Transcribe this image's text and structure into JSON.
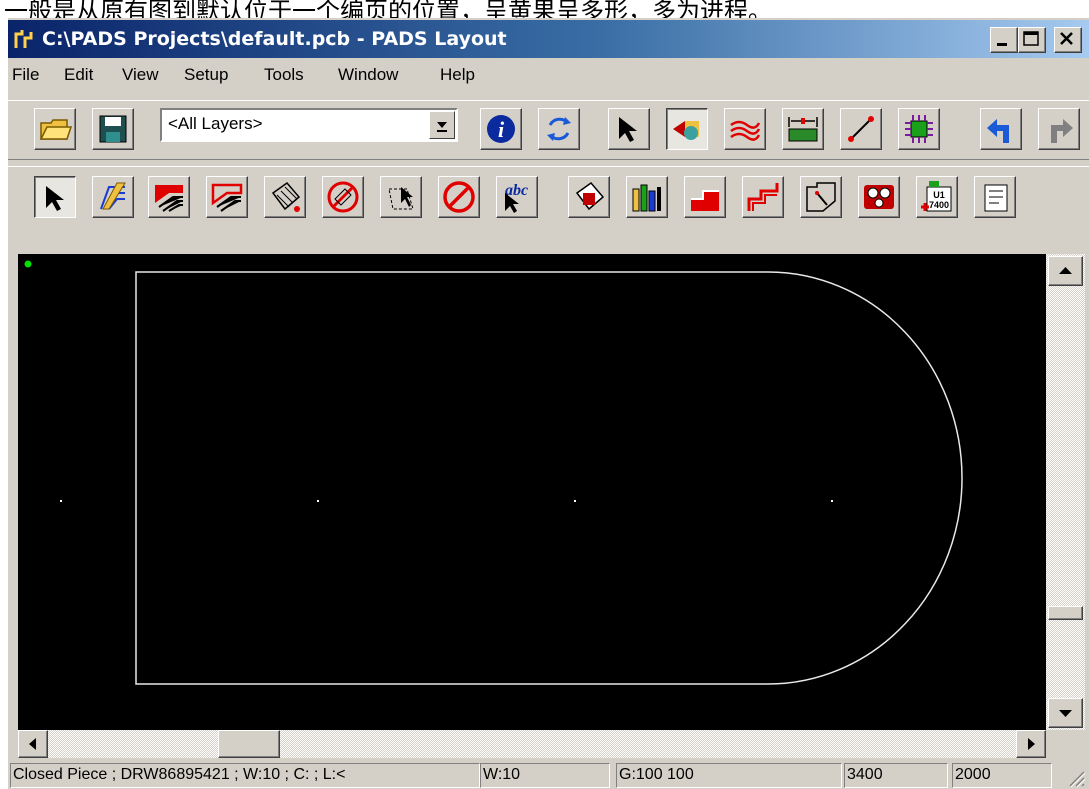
{
  "background_text": "一般是从原有图到默认位于一个编页的位置，呈黄果呈多形，多为进程。",
  "window": {
    "title": "C:\\PADS Projects\\default.pcb - PADS Layout"
  },
  "menu": [
    "File",
    "Edit",
    "View",
    "Setup",
    "Tools",
    "Window",
    "Help"
  ],
  "toolbar1": {
    "layer_select": "<All Layers>",
    "buttons": [
      "open-icon",
      "save-icon",
      "info-icon",
      "refresh-icon",
      "select-icon",
      "design-toolbar-icon",
      "ecos-toolbar-icon",
      "dimension-toolbar-icon",
      "route-icon",
      "bga-icon",
      "undo-icon",
      "redo-icon"
    ]
  },
  "toolbar2": {
    "buttons": [
      "select-mode-icon",
      "board-outline-icon",
      "copper-icon",
      "copper-cutout-icon",
      "copper-pour-icon",
      "copper-pour-cutout-icon",
      "keepout-icon",
      "no-keepout-icon",
      "text-icon",
      "component-icon",
      "2d-line-icon",
      "plane-area-icon",
      "plane-cutout-icon",
      "hatch-icon",
      "terminal-icon",
      "part-icon",
      "field-icon"
    ]
  },
  "status": {
    "info": "Closed Piece ; DRW86895421 ; W:10 ; C: ; L:<",
    "width": "W:10",
    "grid": "G:100 100",
    "x": "3400",
    "y": "2000"
  },
  "colors": {
    "title_start": "#0a246a",
    "title_end": "#a6caf0",
    "canvas": "#000000",
    "outline": "#e8e8e8",
    "origin": "#00ff00"
  }
}
